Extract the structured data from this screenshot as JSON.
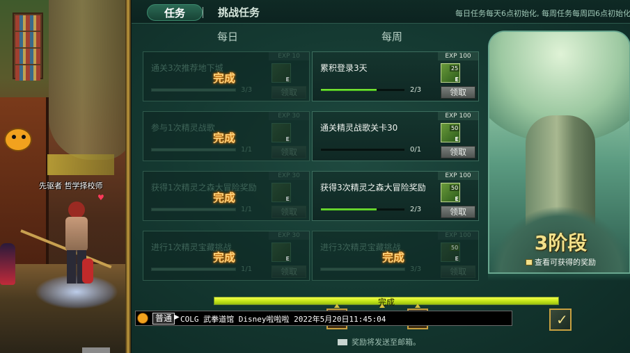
{
  "tabs": [
    {
      "label": "任务",
      "active": true
    },
    {
      "label": "挑战任务",
      "active": false
    }
  ],
  "reset_note": "每日任务每天6点初始化, 每周任务每周四6点初始化",
  "columns": {
    "daily": "每日",
    "weekly": "每周"
  },
  "done_label": "完成",
  "claim_label": "领取",
  "daily_quests": [
    {
      "name": "通关3次推荐地下城",
      "count": "3/3",
      "exp": "EXP 10",
      "qty": "",
      "progress": 1.0,
      "done": true
    },
    {
      "name": "参与1次精灵战歌",
      "count": "1/1",
      "exp": "EXP 30",
      "qty": "",
      "progress": 1.0,
      "done": true
    },
    {
      "name": "获得1次精灵之森大冒险奖励",
      "count": "1/1",
      "exp": "EXP 30",
      "qty": "",
      "progress": 1.0,
      "done": true
    },
    {
      "name": "进行1次精灵宝藏挑战",
      "count": "1/1",
      "exp": "EXP 30",
      "qty": "",
      "progress": 1.0,
      "done": true
    }
  ],
  "weekly_quests": [
    {
      "name": "累积登录3天",
      "count": "2/3",
      "exp": "EXP 100",
      "qty": "25",
      "progress": 0.667,
      "done": false
    },
    {
      "name": "通关精灵战歌关卡30",
      "count": "0/1",
      "exp": "EXP 100",
      "qty": "50",
      "progress": 0.0,
      "done": false
    },
    {
      "name": "获得3次精灵之森大冒险奖励",
      "count": "2/3",
      "exp": "EXP 100",
      "qty": "50",
      "progress": 0.667,
      "done": false
    },
    {
      "name": "进行3次精灵宝藏挑战",
      "count": "3/3",
      "exp": "EXP 100",
      "qty": "50",
      "progress": 1.0,
      "done": true
    }
  ],
  "stage": {
    "level": "3阶段",
    "link": "查看可获得的奖励"
  },
  "track": {
    "label": "完成",
    "progress": 1.0
  },
  "chat": {
    "channel": "普通",
    "text": "COLG 武拳道馆 Disney啦啦啦 2022年5月20日11:45:04"
  },
  "mail_note": "奖励将发送至邮箱。",
  "npc": {
    "title": "先驱者",
    "name": "哲学择校师"
  },
  "colors": {
    "accent_green": "#8aff3a",
    "done_gold": "#ffd27a",
    "stage_gold": "#f2e08a"
  }
}
